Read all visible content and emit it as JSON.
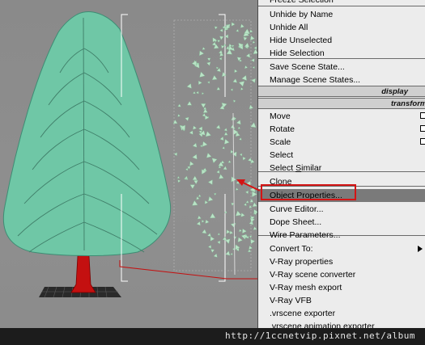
{
  "menu": {
    "items": [
      {
        "id": "freeze",
        "label": "Freeze Selection",
        "underline": "",
        "icon": "",
        "top": 0
      },
      {
        "id": "unhide-by-name",
        "label": "Unhide by Name",
        "underline": "",
        "icon": ""
      },
      {
        "id": "unhide-all",
        "label": "Unhide All",
        "underline": "",
        "icon": ""
      },
      {
        "id": "hide-unselected",
        "label": "Hide Unselected",
        "underline": "",
        "icon": ""
      },
      {
        "id": "hide-selection",
        "label": "Hide Selection",
        "underline": "",
        "icon": ""
      },
      {
        "id": "save-scene-state",
        "label": "Save Scene State...",
        "underline": "",
        "icon": ""
      },
      {
        "id": "manage-scene-states",
        "label": "Manage Scene States...",
        "underline": "",
        "icon": ""
      },
      {
        "id": "move",
        "label": "Move",
        "underline": "",
        "icon": "box-icon"
      },
      {
        "id": "rotate",
        "label": "Rotate",
        "underline": "",
        "icon": "box-icon"
      },
      {
        "id": "scale",
        "label": "Scale",
        "underline": "",
        "icon": "box-icon"
      },
      {
        "id": "select",
        "label": "Select",
        "underline": "",
        "icon": ""
      },
      {
        "id": "select-similar",
        "label": "Select Similar",
        "underline": "S",
        "icon": ""
      },
      {
        "id": "clone",
        "label": "Clone",
        "underline": "",
        "icon": ""
      },
      {
        "id": "object-properties",
        "label": "Object Properties...",
        "underline": "P",
        "icon": "",
        "highlight": true
      },
      {
        "id": "curve-editor",
        "label": "Curve Editor...",
        "underline": "",
        "icon": ""
      },
      {
        "id": "dope-sheet",
        "label": "Dope Sheet...",
        "underline": "",
        "icon": ""
      },
      {
        "id": "wire-parameters",
        "label": "Wire Parameters...",
        "underline": "",
        "icon": ""
      },
      {
        "id": "convert-to",
        "label": "Convert To:",
        "underline": "",
        "icon": "submenu-arrow-icon"
      },
      {
        "id": "vray-properties",
        "label": "V-Ray properties",
        "underline": "",
        "icon": ""
      },
      {
        "id": "vray-scene-converter",
        "label": "V-Ray scene converter",
        "underline": "",
        "icon": ""
      },
      {
        "id": "vray-mesh-export",
        "label": "V-Ray mesh export",
        "underline": "",
        "icon": ""
      },
      {
        "id": "vray-vfb",
        "label": "V-Ray VFB",
        "underline": "",
        "icon": ""
      },
      {
        "id": "vrscene-exporter",
        "label": ".vrscene exporter",
        "underline": "",
        "icon": ""
      },
      {
        "id": "vrscene-animation-exporter",
        "label": ".vrscene animation exporter",
        "underline": "",
        "icon": ""
      }
    ],
    "headers": {
      "display": "display",
      "transform": "transform"
    }
  },
  "colors": {
    "highlight": "#7a7a7a",
    "annotation_red": "#d41414",
    "foliage": "#6fc7a6",
    "trunk": "#c41010"
  },
  "watermark": "http://1ccnetvip.pixnet.net/album"
}
